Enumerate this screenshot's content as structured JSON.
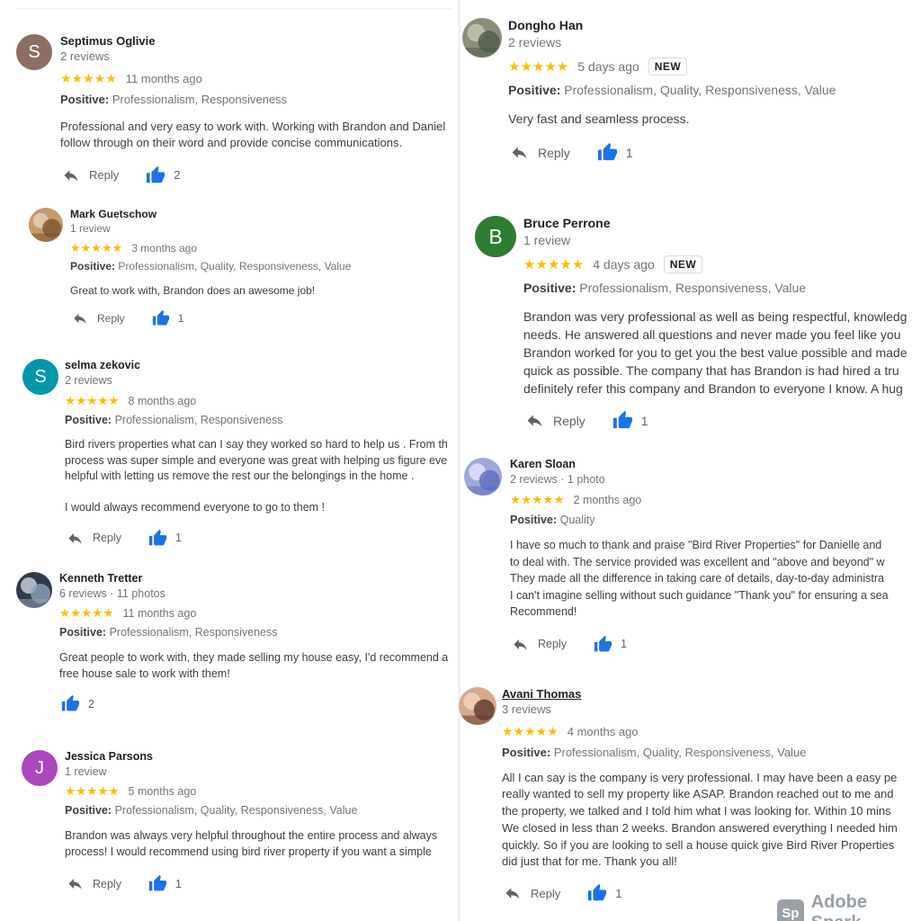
{
  "colors": {
    "star": "#fbbc04",
    "like": "#1a73e8",
    "text": "#3c4043",
    "muted": "#70757a"
  },
  "common": {
    "reply_label": "Reply",
    "stars": "★★★★★",
    "positive_label": "Positive:",
    "new_badge": "NEW"
  },
  "reviews": [
    {
      "name": "Septimus Oglivie",
      "meta": "2 reviews",
      "avatar": {
        "letter": "S",
        "color": "#8d6e63"
      },
      "date": "11 months ago",
      "aspects": "Professionalism, Responsiveness",
      "text": [
        "Professional and very easy to work with.  Working with Brandon and Daniel",
        "follow through on their word and provide concise communications."
      ],
      "likes": "2",
      "reply": true
    },
    {
      "name": "Mark Guetschow",
      "meta": "1 review",
      "avatar": {
        "photo": "photo-avatar-icon"
      },
      "date": "3 months ago",
      "aspects": "Professionalism, Quality, Responsiveness, Value",
      "text": [
        "Great to work with, Brandon does an awesome job!"
      ],
      "likes": "1",
      "reply": true
    },
    {
      "name": "selma zekovic",
      "meta": "2 reviews",
      "avatar": {
        "letter": "S",
        "color": "#0097a7"
      },
      "date": "8 months ago",
      "aspects": "Professionalism, Responsiveness",
      "text": [
        "Bird rivers properties what can I say they worked so hard to help us . From th",
        "process was super simple and everyone was great with helping us figure eve",
        "helpful with letting us remove the rest our the belongings in the home .",
        "",
        "I would always recommend everyone to go to them !"
      ],
      "likes": "1",
      "reply": true
    },
    {
      "name": "Kenneth Tretter",
      "meta": "6 reviews · 11 photos",
      "avatar": {
        "photo": "photo-avatar-icon"
      },
      "date": "11 months ago",
      "aspects": "Professionalism, Responsiveness",
      "text": [
        "Great people to work with, they made selling my house easy, I'd recommend a",
        "free house sale to work with them!"
      ],
      "likes": "2",
      "reply": false
    },
    {
      "name": "Jessica Parsons",
      "meta": "1 review",
      "avatar": {
        "letter": "J",
        "color": "#ab47bc"
      },
      "date": "5 months ago",
      "aspects": "Professionalism, Quality, Responsiveness, Value",
      "text": [
        "Brandon was always very helpful throughout the entire process and always",
        "process! I would recommend using bird river property if you want a simple"
      ],
      "likes": "1",
      "reply": true
    },
    {
      "name": "Dongho Han",
      "meta": "2 reviews",
      "avatar": {
        "photo": "photo-avatar-icon"
      },
      "date": "5 days ago",
      "is_new": true,
      "aspects": "Professionalism, Quality, Responsiveness, Value",
      "text": [
        "Very fast and seamless process."
      ],
      "likes": "1",
      "reply": true
    },
    {
      "name": "Bruce Perrone",
      "meta": "1 review",
      "avatar": {
        "letter": "B",
        "color": "#2e7d32"
      },
      "date": "4 days ago",
      "is_new": true,
      "aspects": "Professionalism, Responsiveness, Value",
      "text": [
        "Brandon was very professional as well as being respectful, knowledg",
        "needs.  He answered all questions and never made you feel like you",
        "Brandon worked for you to get you the best value possible and made",
        "quick as possible.  The company that has Brandon is had hired a tru",
        "definitely refer this company and Brandon to everyone I know.  A hug"
      ],
      "likes": "1",
      "reply": true
    },
    {
      "name": "Karen Sloan",
      "meta": "2 reviews · 1 photo",
      "avatar": {
        "photo": "photo-avatar-icon"
      },
      "date": "2 months ago",
      "aspects": "Quality",
      "text": [
        "I have so much to thank and praise  \"Bird River Properties\"  for  Danielle and",
        "to deal with.  The service provided was excellent and \"above and beyond\" w",
        "They made all the difference in taking care of details, day-to-day administra",
        "I can't imagine selling without such guidance \"Thank you\" for ensuring a sea",
        "Recommend!"
      ],
      "likes": "1",
      "reply": true
    },
    {
      "name": "Avani Thomas",
      "meta": "3 reviews",
      "avatar": {
        "photo": "photo-avatar-icon"
      },
      "date": "4 months ago",
      "aspects": "Professionalism, Quality, Responsiveness, Value",
      "text": [
        "All I can say is the company is very professional. I may have been a easy pe",
        "really wanted to sell my property like ASAP. Brandon reached out to me and",
        "the property, we talked and I told him what I was looking for. Within 10 mins",
        "We closed in less than 2 weeks. Brandon answered everything I needed him",
        "quickly. So if you are looking to sell a house quick give Bird River Properties",
        "did just that for me. Thank you all!"
      ],
      "likes": "1",
      "reply": true
    }
  ],
  "watermark": {
    "badge": "Sp",
    "text": "Adobe Spark"
  }
}
